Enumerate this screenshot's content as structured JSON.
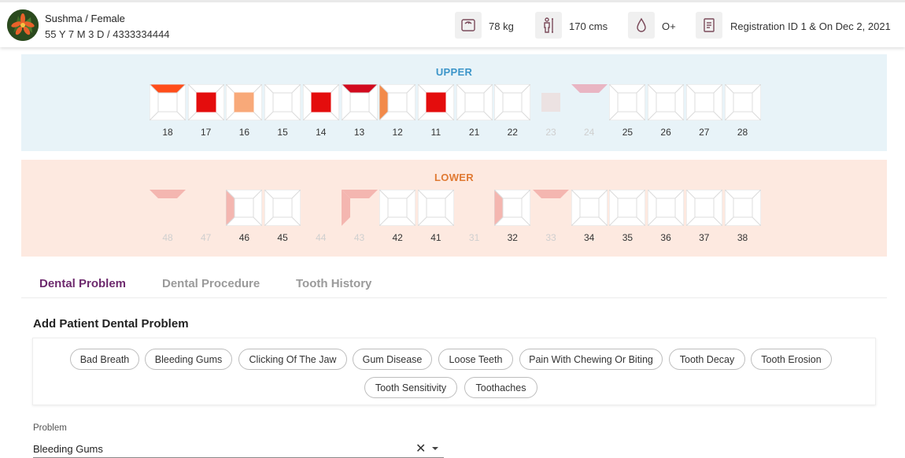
{
  "patient": {
    "name_gender": "Sushma / Female",
    "age_phone": "55 Y 7 M 3 D / 4333334444",
    "weight": "78 kg",
    "height": "170 cms",
    "blood_group": "O+",
    "registration": "Registration ID 1 & On Dec 2, 2021"
  },
  "icons": {
    "weight": "scale-icon",
    "height": "height-icon",
    "blood": "blood-drop-icon",
    "registration": "document-icon"
  },
  "colors": {
    "red": "#e40d0d",
    "orange_red": "#ff4d1a",
    "light_orange": "#f8a979",
    "orange": "#f28a4a",
    "pale_pink": "#f4b6b0",
    "crimson": "#d20a1e",
    "mauve": "#e9b5c3",
    "tab_active": "#6e2a6e",
    "upper_title": "#3c95c9",
    "lower_title": "#e07a33"
  },
  "upper": {
    "title": "UPPER",
    "teeth": [
      {
        "num": "18",
        "faded": false,
        "surfaces": {
          "top": "orange_red"
        }
      },
      {
        "num": "17",
        "faded": false,
        "surfaces": {
          "center": "red"
        }
      },
      {
        "num": "16",
        "faded": false,
        "surfaces": {
          "center": "light_orange"
        }
      },
      {
        "num": "15",
        "faded": false,
        "surfaces": {}
      },
      {
        "num": "14",
        "faded": false,
        "surfaces": {
          "center": "red"
        }
      },
      {
        "num": "13",
        "faded": false,
        "surfaces": {
          "top": "crimson"
        }
      },
      {
        "num": "12",
        "faded": false,
        "surfaces": {
          "left": "orange"
        }
      },
      {
        "num": "11",
        "faded": false,
        "surfaces": {
          "center": "red"
        }
      },
      {
        "num": "21",
        "faded": false,
        "surfaces": {}
      },
      {
        "num": "22",
        "faded": false,
        "surfaces": {}
      },
      {
        "num": "23",
        "faded": true,
        "surfaces": {
          "center": "#ece2e2"
        }
      },
      {
        "num": "24",
        "faded": true,
        "surfaces": {
          "top": "mauve"
        }
      },
      {
        "num": "25",
        "faded": false,
        "surfaces": {}
      },
      {
        "num": "26",
        "faded": false,
        "surfaces": {}
      },
      {
        "num": "27",
        "faded": false,
        "surfaces": {}
      },
      {
        "num": "28",
        "faded": false,
        "surfaces": {}
      }
    ]
  },
  "lower": {
    "title": "LOWER",
    "teeth": [
      {
        "num": "48",
        "faded": true,
        "surfaces": {
          "top": "pale_pink"
        }
      },
      {
        "num": "47",
        "faded": true,
        "surfaces": {}
      },
      {
        "num": "46",
        "faded": false,
        "surfaces": {
          "left": "pale_pink"
        }
      },
      {
        "num": "45",
        "faded": false,
        "surfaces": {}
      },
      {
        "num": "44",
        "faded": true,
        "surfaces": {}
      },
      {
        "num": "43",
        "faded": true,
        "surfaces": {
          "top": "pale_pink",
          "left": "pale_pink"
        }
      },
      {
        "num": "42",
        "faded": false,
        "surfaces": {}
      },
      {
        "num": "41",
        "faded": false,
        "surfaces": {}
      },
      {
        "num": "31",
        "faded": true,
        "surfaces": {}
      },
      {
        "num": "32",
        "faded": false,
        "surfaces": {
          "left": "pale_pink"
        }
      },
      {
        "num": "33",
        "faded": true,
        "surfaces": {
          "top": "pale_pink"
        }
      },
      {
        "num": "34",
        "faded": false,
        "surfaces": {}
      },
      {
        "num": "35",
        "faded": false,
        "surfaces": {}
      },
      {
        "num": "36",
        "faded": false,
        "surfaces": {}
      },
      {
        "num": "37",
        "faded": false,
        "surfaces": {}
      },
      {
        "num": "38",
        "faded": false,
        "surfaces": {}
      }
    ]
  },
  "tabs": [
    {
      "label": "Dental Problem",
      "active": true
    },
    {
      "label": "Dental Procedure",
      "active": false
    },
    {
      "label": "Tooth History",
      "active": false
    }
  ],
  "section_title": "Add Patient Dental Problem",
  "chips": [
    "Bad Breath",
    "Bleeding Gums",
    "Clicking Of The Jaw",
    "Gum Disease",
    "Loose Teeth",
    "Pain With Chewing Or Biting",
    "Tooth Decay",
    "Tooth Erosion",
    "Tooth Sensitivity",
    "Toothaches"
  ],
  "problem_field": {
    "label": "Problem",
    "value": "Bleeding Gums",
    "clear_symbol": "✕"
  }
}
